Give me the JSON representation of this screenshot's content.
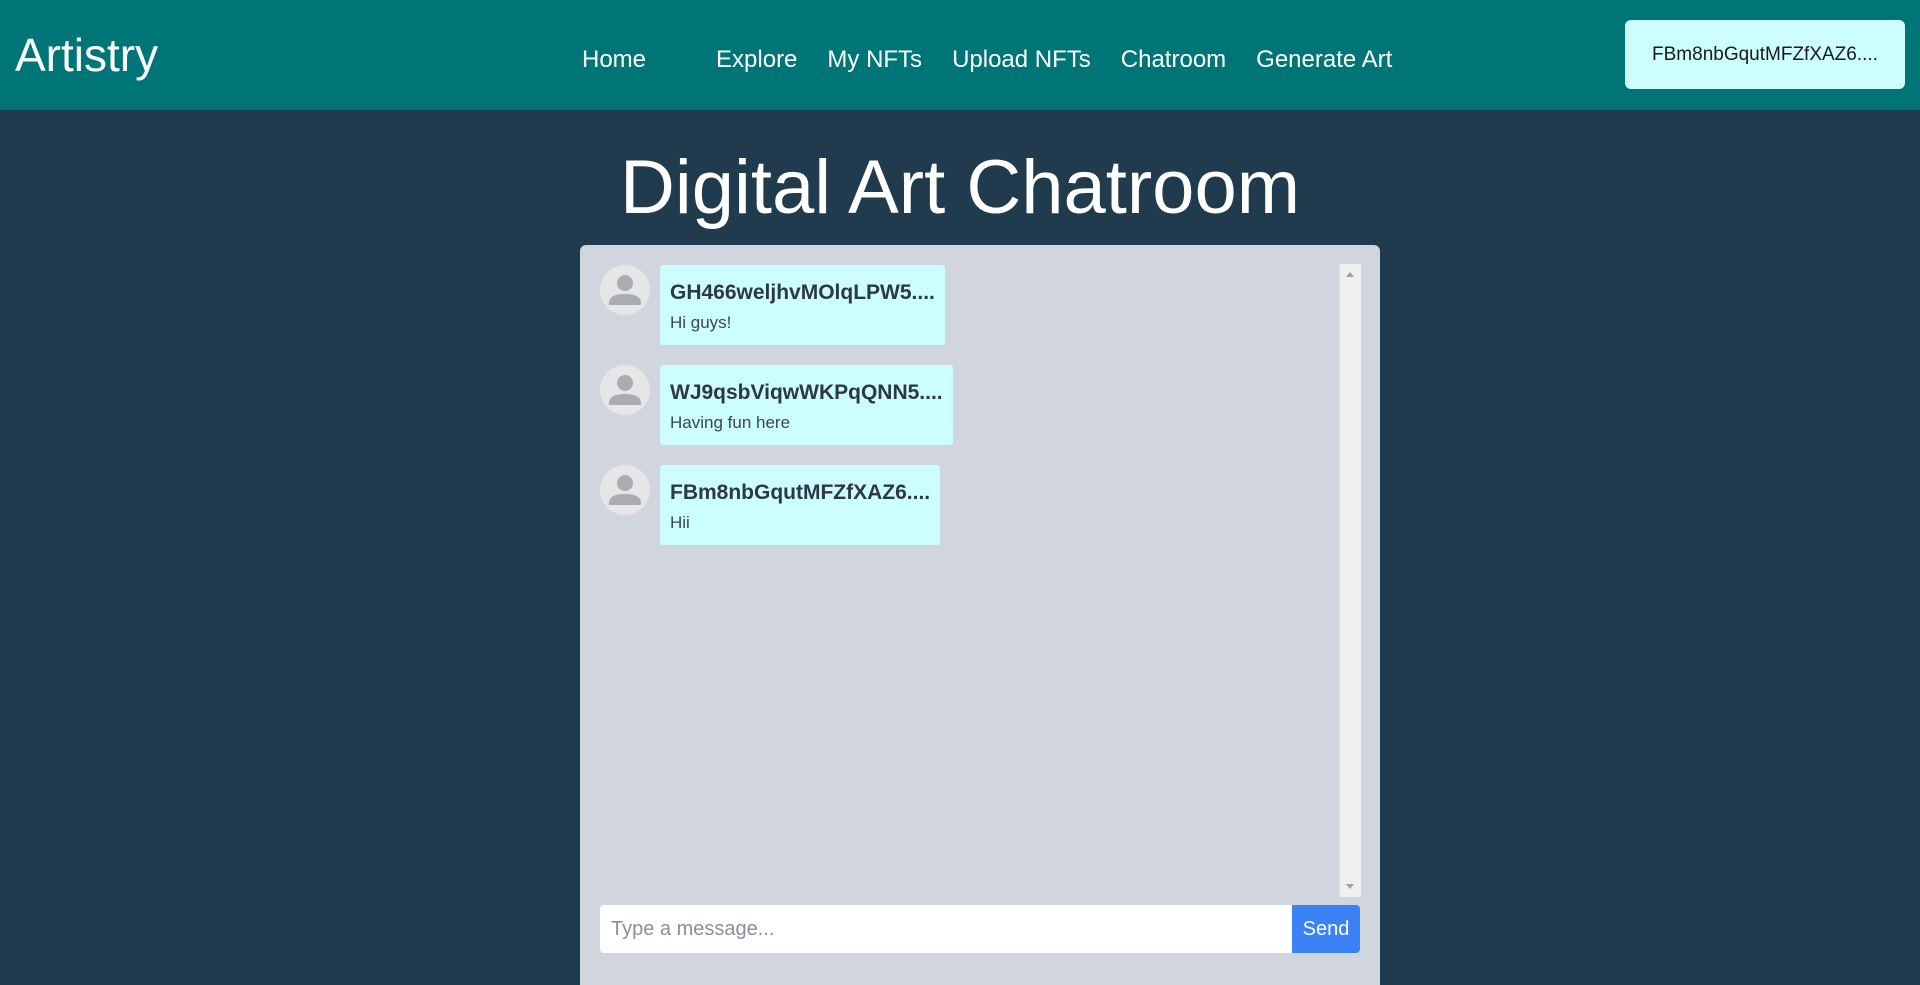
{
  "navbar": {
    "brand": "Artistry",
    "links": [
      {
        "label": "Home"
      },
      {
        "label": "Explore"
      },
      {
        "label": "My NFTs"
      },
      {
        "label": "Upload NFTs"
      },
      {
        "label": "Chatroom"
      },
      {
        "label": "Generate Art"
      }
    ],
    "wallet_address": "FBm8nbGqutMFZfXAZ6...."
  },
  "page": {
    "title": "Digital Art Chatroom"
  },
  "chat": {
    "messages": [
      {
        "sender": "GH466weljhvMOlqLPW5....",
        "text": "Hi guys!",
        "avatar_icon": "user-avatar-icon"
      },
      {
        "sender": "WJ9qsbViqwWKPqQNN5....",
        "text": "Having fun here",
        "avatar_icon": "user-avatar-icon"
      },
      {
        "sender": "FBm8nbGqutMFZfXAZ6....",
        "text": "Hii",
        "avatar_icon": "user-avatar-icon"
      }
    ],
    "input_placeholder": "Type a message...",
    "input_value": "",
    "send_label": "Send"
  },
  "colors": {
    "navbar_bg": "#007577",
    "page_bg": "#203a4e",
    "panel_bg": "#d1d5dd",
    "bubble_bg": "#ccfefe",
    "send_button_bg": "#3b82f6"
  }
}
